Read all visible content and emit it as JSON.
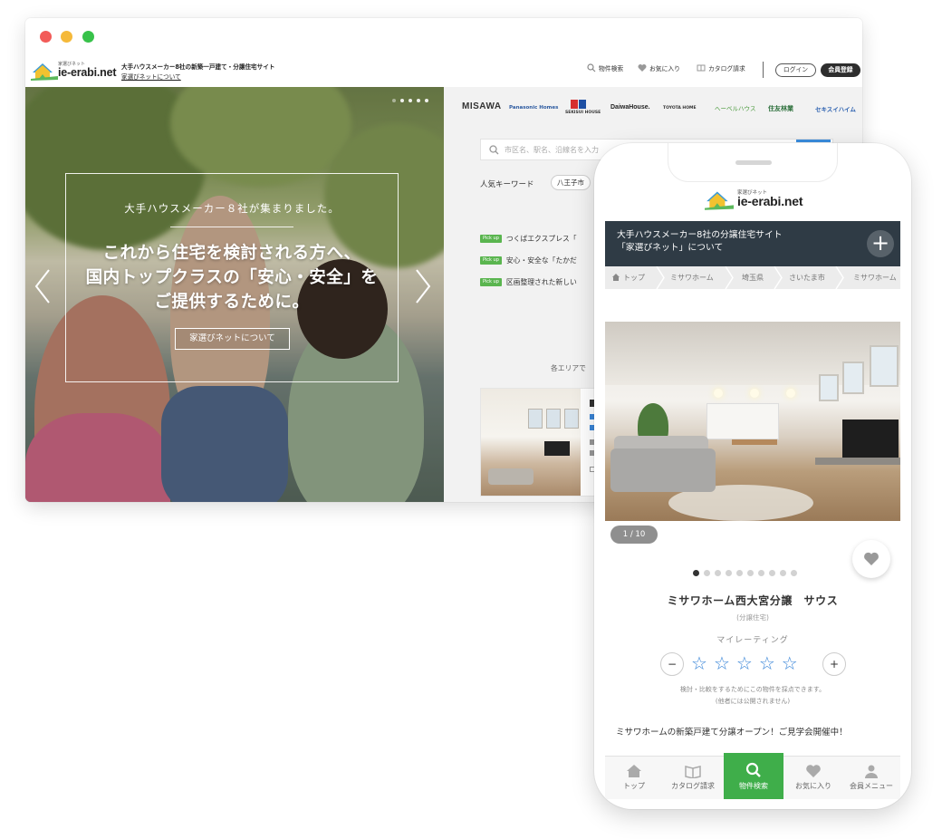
{
  "desktop": {
    "header": {
      "logo_small": "家選びネット",
      "logo_text": "ie-erabi.net",
      "tagline": "大手ハウスメーカー8社の新築一戸建て・分譲住宅サイト",
      "about_link": "家選びネットについて",
      "nav": {
        "search": "物件検索",
        "favorites": "お気に入り",
        "catalog": "カタログ請求"
      },
      "login": "ログイン",
      "register": "会員登録"
    },
    "hero": {
      "subtitle": "大手ハウスメーカー８社が集まりました。",
      "main_line1": "これから住宅を検討される方へ、",
      "main_line2": "国内トップクラスの「安心・安全」を",
      "main_line3": "ご提供するために。",
      "button": "家選びネットについて"
    },
    "brands": [
      "MISAWA",
      "Panasonic Homes",
      "SEKISUI HOUSE",
      "DaiwaHouse.",
      "TOYOTA HOME",
      "へーベルハウス",
      "住友林業",
      "セキスイハイム"
    ],
    "search": {
      "placeholder": "市区名、駅名、沿線名を入力"
    },
    "keywords": {
      "label": "人気キーワード",
      "chip": "八王子市"
    },
    "pickups": {
      "badge": "Pick up",
      "items": [
        "つくばエクスプレス「",
        "安心・安全な「たかだ",
        "区画整理された新しい"
      ]
    },
    "area_label": "各エリアで",
    "colors": {
      "accent_green": "#5ab54f",
      "header_dark": "#2e2e2e"
    }
  },
  "mobile": {
    "logo_small": "家選びネット",
    "logo_text": "ie-erabi.net",
    "banner_line1": "大手ハウスメーカー8社の分譲住宅サイト",
    "banner_line2": "「家選びネット」について",
    "plus": "+",
    "breadcrumb": [
      "トップ",
      "ミサワホーム",
      "埼玉県",
      "さいたま市",
      "ミサワホーム"
    ],
    "pager": "1 / 10",
    "property_title": "ミサワホーム西大宮分譲　サウス",
    "property_type": "(分譲住宅)",
    "rating_label": "マイレーティング",
    "minus": "−",
    "add": "+",
    "stars": [
      "☆",
      "☆",
      "☆",
      "☆",
      "☆"
    ],
    "rating_note1": "検討・比較をするためにこの物件を採点できます。",
    "rating_note2": "(他者には公開されません)",
    "catch": "ミサワホームの新築戸建て分譲オープン！ご見学会開催中！",
    "tabs": [
      "トップ",
      "カタログ請求",
      "物件検索",
      "お気に入り",
      "会員メニュー"
    ],
    "colors": {
      "tab_active": "#3fae4a",
      "star": "#3a86d8",
      "banner": "#2f3b45"
    }
  }
}
